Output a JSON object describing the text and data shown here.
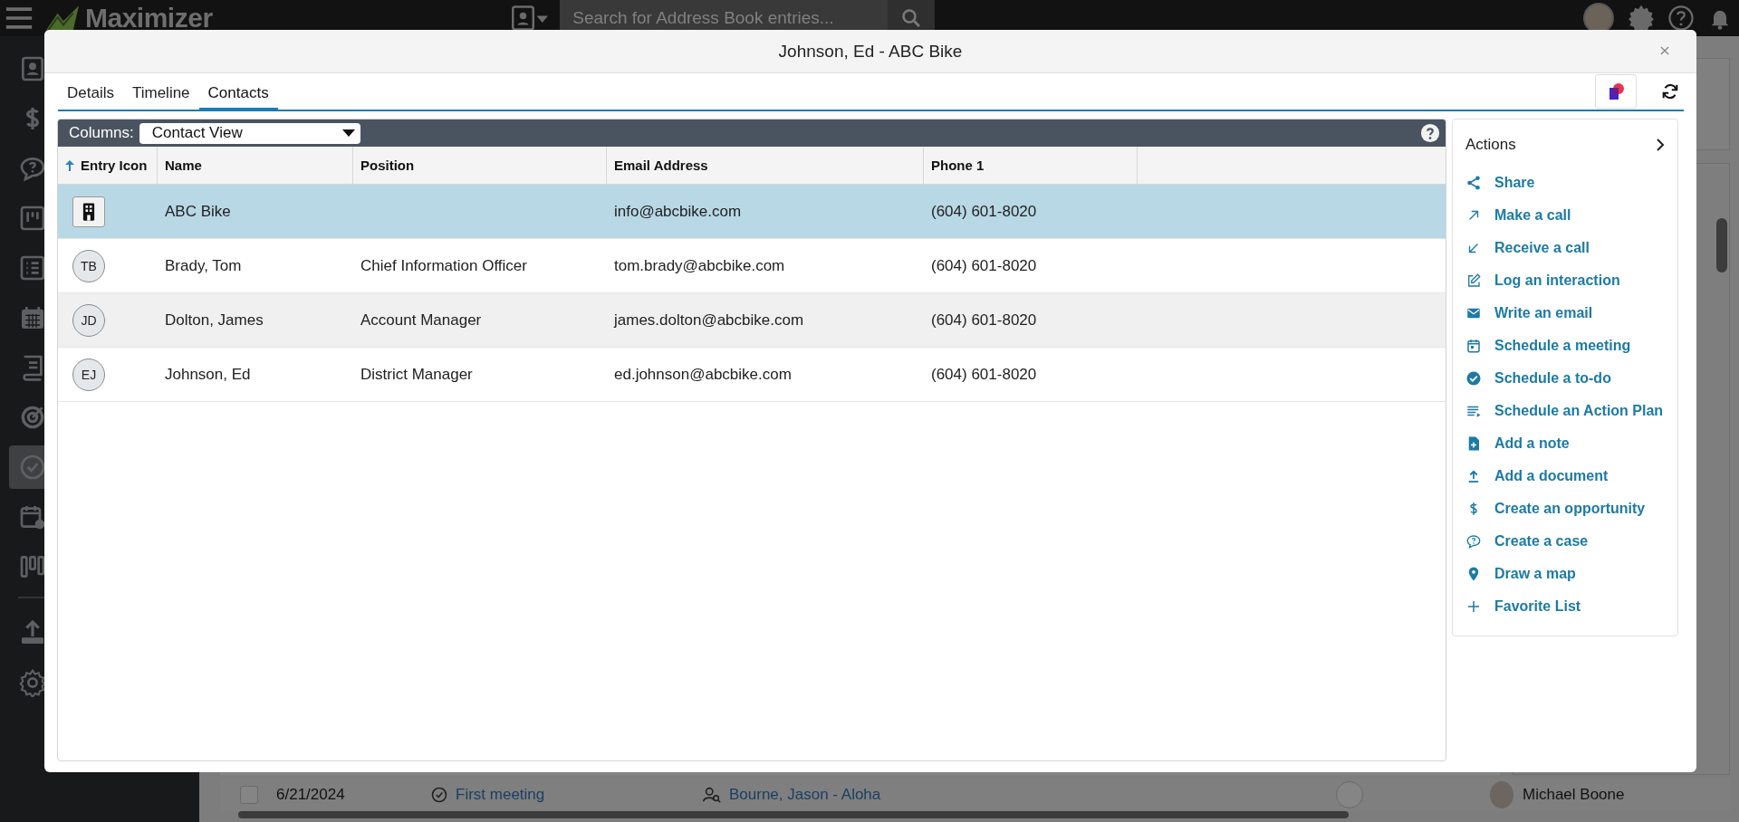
{
  "top_bar": {
    "logo": "Maximizer",
    "search": {
      "placeholder": "Search for Address Book entries..."
    }
  },
  "sidebar": {
    "items": [
      {
        "kind": "contact",
        "selected": false
      },
      {
        "kind": "dollar",
        "selected": false
      },
      {
        "kind": "case",
        "selected": false
      },
      {
        "kind": "board",
        "selected": false
      },
      {
        "kind": "list",
        "selected": false
      },
      {
        "kind": "calendar",
        "selected": false
      },
      {
        "kind": "book",
        "selected": false
      },
      {
        "kind": "target",
        "selected": false
      },
      {
        "kind": "check",
        "selected": true
      },
      {
        "kind": "schedule",
        "selected": false
      },
      {
        "kind": "columns",
        "selected": false
      },
      {
        "kind": "upload",
        "selected": false
      },
      {
        "kind": "settings",
        "selected": false
      }
    ]
  },
  "background_row": {
    "checked": false,
    "date": "6/21/2024",
    "activity": "First meeting",
    "contact": "Bourne, Jason - Aloha",
    "owner": "Michael Boone"
  },
  "dialog": {
    "title": "Johnson, Ed - ABC Bike",
    "tabs": [
      {
        "label": "Details",
        "selected": false
      },
      {
        "label": "Timeline",
        "selected": false
      },
      {
        "label": "Contacts",
        "selected": true
      }
    ],
    "grid": {
      "columns_label": "Columns:",
      "view": "Contact View",
      "columns": [
        {
          "label": "Entry Icon",
          "sorted": true
        },
        {
          "label": "Name",
          "sorted": false
        },
        {
          "label": "Position",
          "sorted": false
        },
        {
          "label": "Email Address",
          "sorted": false
        },
        {
          "label": "Phone 1",
          "sorted": false
        }
      ],
      "rows": [
        {
          "kind": "company",
          "selected": true,
          "name": "ABC Bike",
          "email": "info@abcbike.com",
          "phone": "(604) 601-8020"
        },
        {
          "kind": "person",
          "initials": "TB",
          "selected": false,
          "name": "Brady, Tom",
          "position": "Chief Information Officer",
          "email": "tom.brady@abcbike.com",
          "phone": "(604) 601-8020"
        },
        {
          "kind": "person",
          "initials": "JD",
          "selected": false,
          "name": "Dolton, James",
          "position": "Account Manager",
          "email": "james.dolton@abcbike.com",
          "phone": "(604) 601-8020"
        },
        {
          "kind": "person",
          "initials": "EJ",
          "selected": false,
          "name": "Johnson, Ed",
          "position": "District Manager",
          "email": "ed.johnson@abcbike.com",
          "phone": "(604) 601-8020"
        }
      ]
    },
    "actions": {
      "title": "Actions",
      "items": [
        {
          "kind": "share",
          "label": "Share"
        },
        {
          "kind": "call-out",
          "label": "Make a call"
        },
        {
          "kind": "call-in",
          "label": "Receive a call"
        },
        {
          "kind": "edit",
          "label": "Log an interaction"
        },
        {
          "kind": "email",
          "label": "Write an email"
        },
        {
          "kind": "meeting",
          "label": "Schedule a meeting"
        },
        {
          "kind": "todo",
          "label": "Schedule a to-do"
        },
        {
          "kind": "plan",
          "label": "Schedule an Action Plan"
        },
        {
          "kind": "note",
          "label": "Add a note"
        },
        {
          "kind": "document",
          "label": "Add a document"
        },
        {
          "kind": "dollar",
          "label": "Create an opportunity"
        },
        {
          "kind": "case",
          "label": "Create a case"
        },
        {
          "kind": "map",
          "label": "Draw a map"
        },
        {
          "kind": "plus",
          "label": "Favorite List"
        }
      ]
    }
  }
}
